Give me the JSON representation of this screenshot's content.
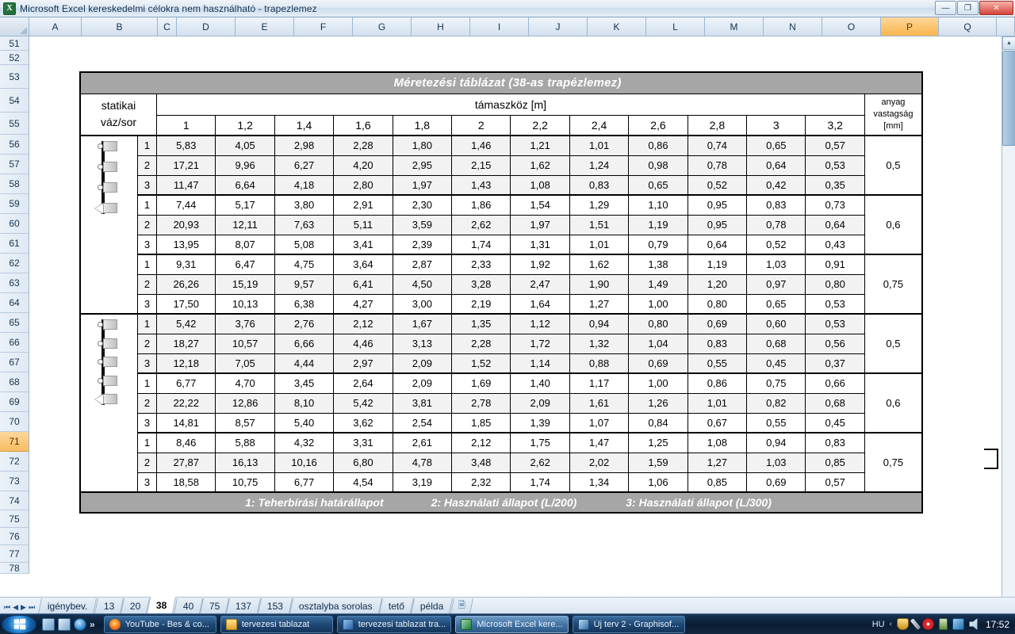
{
  "window": {
    "title": "Microsoft Excel kereskedelmi célokra nem használható - trapezlemez",
    "app_icon": "excel-icon",
    "minimize_label": "—",
    "maximize_label": "❐",
    "close_label": "✕"
  },
  "grid": {
    "columns": [
      "A",
      "B",
      "C",
      "D",
      "E",
      "F",
      "G",
      "H",
      "I",
      "J",
      "K",
      "L",
      "M",
      "N",
      "O",
      "P",
      "Q"
    ],
    "selected_column": "P",
    "rows": [
      "51",
      "52",
      "53",
      "54",
      "55",
      "56",
      "57",
      "58",
      "59",
      "60",
      "61",
      "62",
      "63",
      "64",
      "65",
      "66",
      "67",
      "68",
      "69",
      "70",
      "71",
      "72",
      "73",
      "74",
      "75",
      "76",
      "77",
      "78"
    ],
    "selected_row": "71"
  },
  "table": {
    "title": "Méretezési táblázat (38-as trapézlemez)",
    "row_header_label_line1": "statikai",
    "row_header_label_line2": "váz/sor",
    "span_group_header": "támaszköz [m]",
    "span_values": [
      "1",
      "1,2",
      "1,4",
      "1,6",
      "1,8",
      "2",
      "2,2",
      "2,4",
      "2,6",
      "2,8",
      "3",
      "3,2"
    ],
    "thickness_header_line1": "anyag",
    "thickness_header_line2": "vastagság",
    "thickness_header_line3": "[mm]",
    "groups": [
      {
        "scheme": "three-span-continuous-beam",
        "supports": 4,
        "thickness_blocks": [
          {
            "thickness": "0,5",
            "rows": [
              {
                "idx": "1",
                "values": [
                  "5,83",
                  "4,05",
                  "2,98",
                  "2,28",
                  "1,80",
                  "1,46",
                  "1,21",
                  "1,01",
                  "0,86",
                  "0,74",
                  "0,65",
                  "0,57"
                ]
              },
              {
                "idx": "2",
                "values": [
                  "17,21",
                  "9,96",
                  "6,27",
                  "4,20",
                  "2,95",
                  "2,15",
                  "1,62",
                  "1,24",
                  "0,98",
                  "0,78",
                  "0,64",
                  "0,53"
                ]
              },
              {
                "idx": "3",
                "values": [
                  "11,47",
                  "6,64",
                  "4,18",
                  "2,80",
                  "1,97",
                  "1,43",
                  "1,08",
                  "0,83",
                  "0,65",
                  "0,52",
                  "0,42",
                  "0,35"
                ]
              }
            ]
          },
          {
            "thickness": "0,6",
            "rows": [
              {
                "idx": "1",
                "values": [
                  "7,44",
                  "5,17",
                  "3,80",
                  "2,91",
                  "2,30",
                  "1,86",
                  "1,54",
                  "1,29",
                  "1,10",
                  "0,95",
                  "0,83",
                  "0,73"
                ]
              },
              {
                "idx": "2",
                "values": [
                  "20,93",
                  "12,11",
                  "7,63",
                  "5,11",
                  "3,59",
                  "2,62",
                  "1,97",
                  "1,51",
                  "1,19",
                  "0,95",
                  "0,78",
                  "0,64"
                ]
              },
              {
                "idx": "3",
                "values": [
                  "13,95",
                  "8,07",
                  "5,08",
                  "3,41",
                  "2,39",
                  "1,74",
                  "1,31",
                  "1,01",
                  "0,79",
                  "0,64",
                  "0,52",
                  "0,43"
                ]
              }
            ]
          },
          {
            "thickness": "0,75",
            "rows": [
              {
                "idx": "1",
                "values": [
                  "9,31",
                  "6,47",
                  "4,75",
                  "3,64",
                  "2,87",
                  "2,33",
                  "1,92",
                  "1,62",
                  "1,38",
                  "1,19",
                  "1,03",
                  "0,91"
                ]
              },
              {
                "idx": "2",
                "values": [
                  "26,26",
                  "15,19",
                  "9,57",
                  "6,41",
                  "4,50",
                  "3,28",
                  "2,47",
                  "1,90",
                  "1,49",
                  "1,20",
                  "0,97",
                  "0,80"
                ]
              },
              {
                "idx": "3",
                "values": [
                  "17,50",
                  "10,13",
                  "6,38",
                  "4,27",
                  "3,00",
                  "2,19",
                  "1,64",
                  "1,27",
                  "1,00",
                  "0,80",
                  "0,65",
                  "0,53"
                ]
              }
            ]
          }
        ]
      },
      {
        "scheme": "four-span-continuous-beam",
        "supports": 5,
        "thickness_blocks": [
          {
            "thickness": "0,5",
            "rows": [
              {
                "idx": "1",
                "values": [
                  "5,42",
                  "3,76",
                  "2,76",
                  "2,12",
                  "1,67",
                  "1,35",
                  "1,12",
                  "0,94",
                  "0,80",
                  "0,69",
                  "0,60",
                  "0,53"
                ]
              },
              {
                "idx": "2",
                "values": [
                  "18,27",
                  "10,57",
                  "6,66",
                  "4,46",
                  "3,13",
                  "2,28",
                  "1,72",
                  "1,32",
                  "1,04",
                  "0,83",
                  "0,68",
                  "0,56"
                ]
              },
              {
                "idx": "3",
                "values": [
                  "12,18",
                  "7,05",
                  "4,44",
                  "2,97",
                  "2,09",
                  "1,52",
                  "1,14",
                  "0,88",
                  "0,69",
                  "0,55",
                  "0,45",
                  "0,37"
                ]
              }
            ]
          },
          {
            "thickness": "0,6",
            "rows": [
              {
                "idx": "1",
                "values": [
                  "6,77",
                  "4,70",
                  "3,45",
                  "2,64",
                  "2,09",
                  "1,69",
                  "1,40",
                  "1,17",
                  "1,00",
                  "0,86",
                  "0,75",
                  "0,66"
                ]
              },
              {
                "idx": "2",
                "values": [
                  "22,22",
                  "12,86",
                  "8,10",
                  "5,42",
                  "3,81",
                  "2,78",
                  "2,09",
                  "1,61",
                  "1,26",
                  "1,01",
                  "0,82",
                  "0,68"
                ]
              },
              {
                "idx": "3",
                "values": [
                  "14,81",
                  "8,57",
                  "5,40",
                  "3,62",
                  "2,54",
                  "1,85",
                  "1,39",
                  "1,07",
                  "0,84",
                  "0,67",
                  "0,55",
                  "0,45"
                ]
              }
            ]
          },
          {
            "thickness": "0,75",
            "rows": [
              {
                "idx": "1",
                "values": [
                  "8,46",
                  "5,88",
                  "4,32",
                  "3,31",
                  "2,61",
                  "2,12",
                  "1,75",
                  "1,47",
                  "1,25",
                  "1,08",
                  "0,94",
                  "0,83"
                ]
              },
              {
                "idx": "2",
                "values": [
                  "27,87",
                  "16,13",
                  "10,16",
                  "6,80",
                  "4,78",
                  "3,48",
                  "2,62",
                  "2,02",
                  "1,59",
                  "1,27",
                  "1,03",
                  "0,85"
                ]
              },
              {
                "idx": "3",
                "values": [
                  "18,58",
                  "10,75",
                  "6,77",
                  "4,54",
                  "3,19",
                  "2,32",
                  "1,74",
                  "1,34",
                  "1,06",
                  "0,85",
                  "0,69",
                  "0,57"
                ]
              }
            ]
          }
        ]
      }
    ],
    "legend": {
      "item1": "1: Teherbírási határállapot",
      "item2": "2: Használati állapot (L/200)",
      "item3": "3: Használati állapot (L/300)"
    }
  },
  "sheet_tabs": {
    "nav_first": "⏮",
    "nav_prev": "◀",
    "nav_next": "▶",
    "nav_last": "⏭",
    "tabs": [
      {
        "label": "igénybev.",
        "active": false
      },
      {
        "label": "13",
        "active": false
      },
      {
        "label": "20",
        "active": false
      },
      {
        "label": "38",
        "active": true
      },
      {
        "label": "40",
        "active": false
      },
      {
        "label": "75",
        "active": false
      },
      {
        "label": "137",
        "active": false
      },
      {
        "label": "153",
        "active": false
      },
      {
        "label": "osztalyba sorolas",
        "active": false
      },
      {
        "label": "tető",
        "active": false
      },
      {
        "label": "példa",
        "active": false
      }
    ],
    "new_sheet_icon": "new-sheet-icon"
  },
  "taskbar": {
    "start_label": "start-orb",
    "quick_launch": [
      "show-desktop-icon",
      "switch-window-icon",
      "internet-explorer-icon"
    ],
    "overflow_label": "»",
    "buttons": [
      {
        "label": "YouTube - Bes & co...",
        "icon": "firefox-icon",
        "active": false
      },
      {
        "label": "tervezesi tablazat",
        "icon": "folder-icon",
        "active": false
      },
      {
        "label": "tervezesi tablazat tra...",
        "icon": "word-icon",
        "active": false
      },
      {
        "label": "Microsoft Excel kere...",
        "icon": "excel-icon",
        "active": true
      },
      {
        "label": "Új terv 2 - Graphisof...",
        "icon": "archicad-icon",
        "active": false
      }
    ],
    "language": "HU",
    "tray_icons": [
      "show-hidden-icons",
      "security-shield-icon",
      "pen-icon",
      "opera-icon",
      "battery-icon",
      "network-icon",
      "volume-icon"
    ],
    "clock": "17:52"
  },
  "colors": {
    "band_gray": "#a6a6a6",
    "alt_row": "#f2f2f2",
    "selection_orange": "#f8b64c",
    "header_blue": "#d3e0ee"
  }
}
